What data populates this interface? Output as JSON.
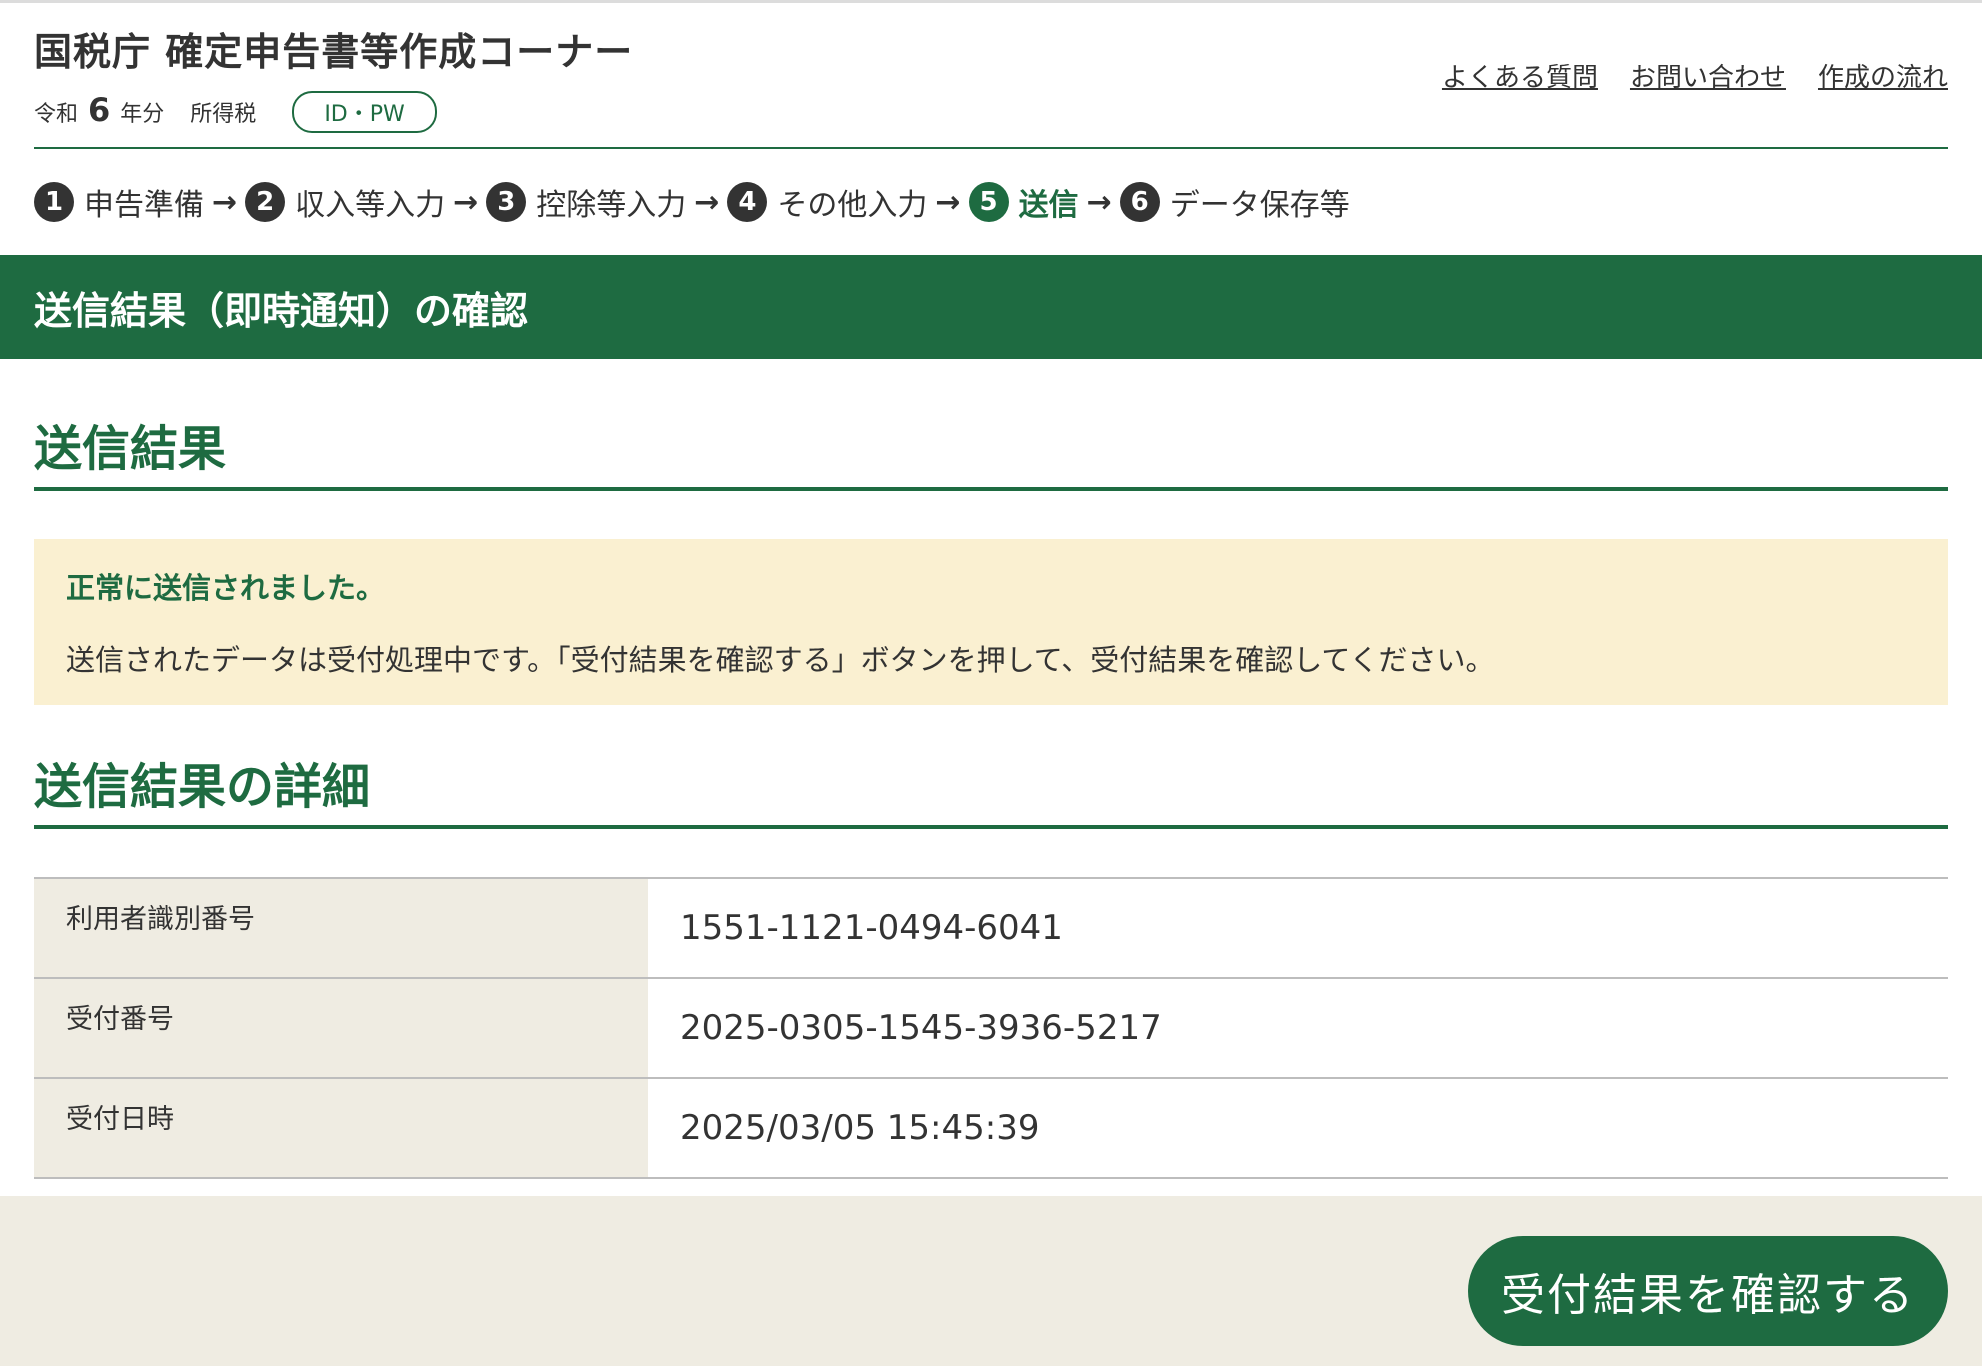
{
  "header": {
    "title": "国税庁 確定申告書等作成コーナー",
    "era": "令和",
    "year": "6",
    "year_suffix": "年分",
    "tax_type": "所得税",
    "badge": "ID・PW",
    "links": [
      "よくある質問",
      "お問い合わせ",
      "作成の流れ"
    ]
  },
  "steps": [
    {
      "num": "1",
      "label": "申告準備"
    },
    {
      "num": "2",
      "label": "収入等入力"
    },
    {
      "num": "3",
      "label": "控除等入力"
    },
    {
      "num": "4",
      "label": "その他入力"
    },
    {
      "num": "5",
      "label": "送信",
      "active": true
    },
    {
      "num": "6",
      "label": "データ保存等"
    }
  ],
  "step_arrow": "→",
  "banner": "送信結果（即時通知）の確認",
  "result_section": {
    "title": "送信結果",
    "notice_title": "正常に送信されました。",
    "notice_body": "送信されたデータは受付処理中です。「受付結果を確認する」ボタンを押して、受付結果を確認してください。"
  },
  "detail_section": {
    "title": "送信結果の詳細",
    "rows": [
      {
        "label": "利用者識別番号",
        "value": "1551-1121-0494-6041"
      },
      {
        "label": "受付番号",
        "value": "2025-0305-1545-3936-5217"
      },
      {
        "label": "受付日時",
        "value": "2025/03/05 15:45:39"
      }
    ]
  },
  "confirm_button": "受付結果を確認する",
  "colors": {
    "accent": "#1e6b41",
    "notice_bg": "#faf0d1",
    "label_bg": "#efece2"
  }
}
